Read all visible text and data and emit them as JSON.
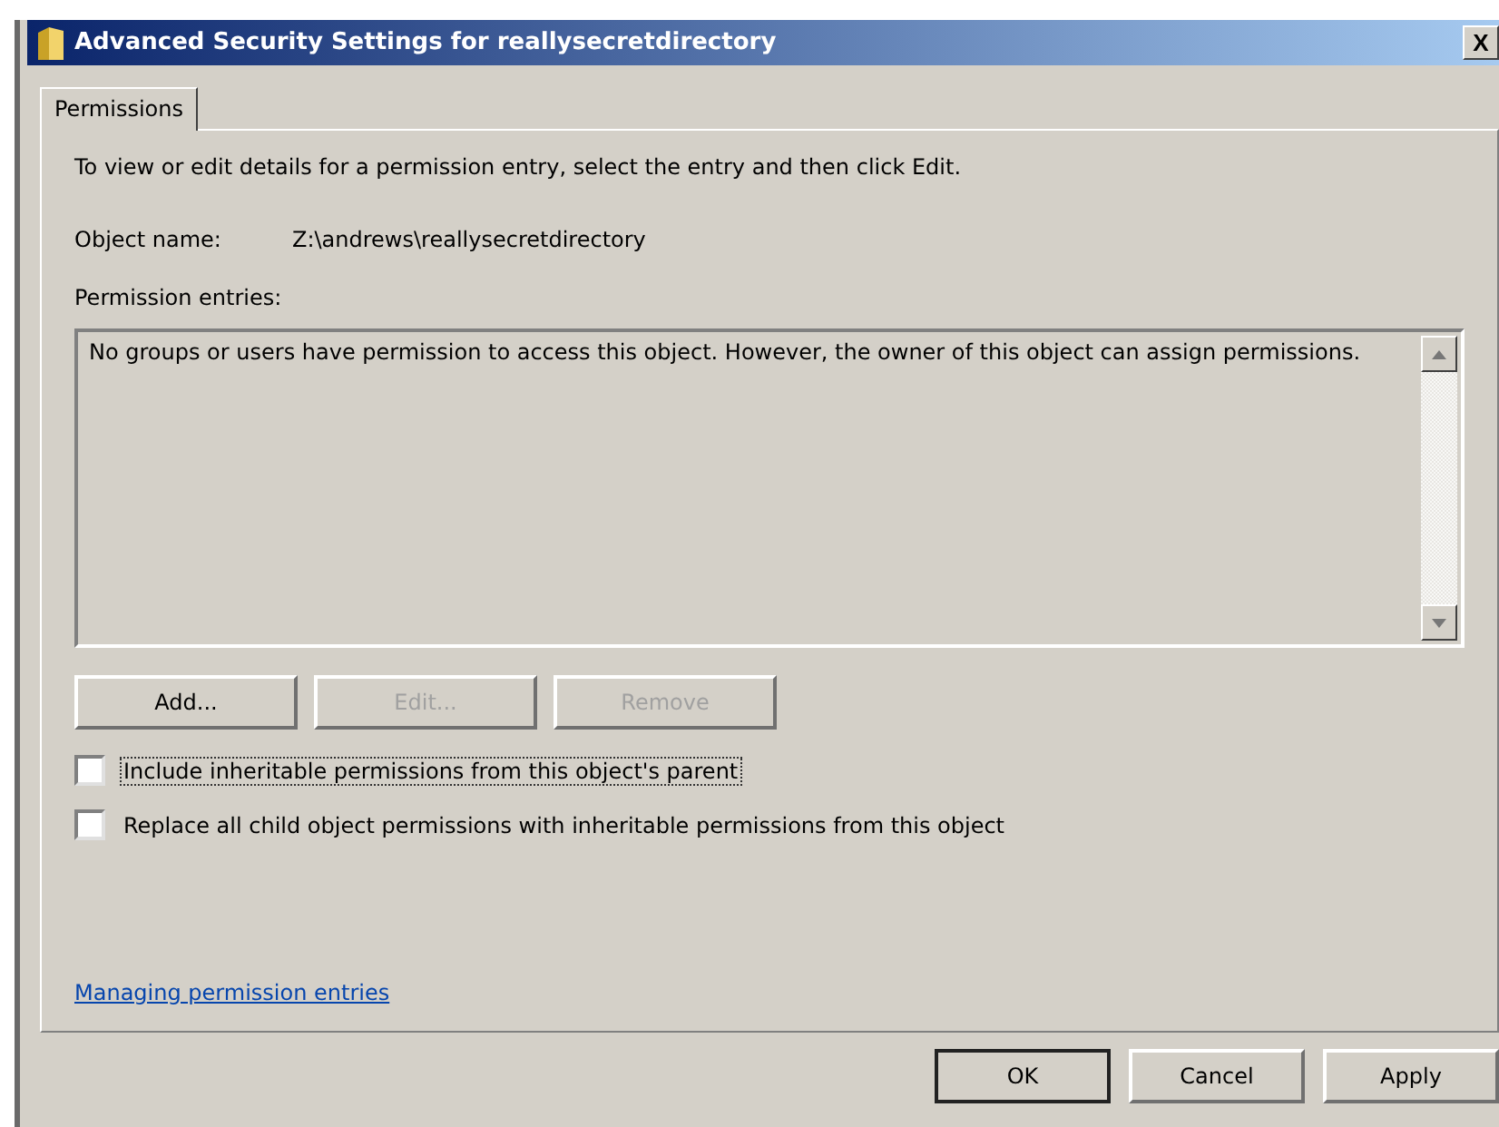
{
  "window": {
    "title": "Advanced Security Settings for reallysecretdirectory",
    "close": "X"
  },
  "tabs": [
    {
      "label": "Permissions",
      "selected": true
    }
  ],
  "intro": "To view or edit details for a permission entry, select the entry and then click Edit.",
  "object_name": {
    "label": "Object name:",
    "value": "Z:\\andrews\\reallysecretdirectory"
  },
  "entries": {
    "label": "Permission entries:",
    "message": "No groups or users have permission to access this object. However, the owner of this object can assign permissions."
  },
  "entry_buttons": [
    {
      "label": "Add...",
      "disabled": false
    },
    {
      "label": "Edit...",
      "disabled": true
    },
    {
      "label": "Remove",
      "disabled": true
    }
  ],
  "options": [
    {
      "label": "Include inheritable permissions from this object's parent",
      "checked": false,
      "focused": true
    },
    {
      "label": "Replace all child object permissions with inheritable permissions from this object",
      "checked": false,
      "focused": false
    }
  ],
  "help_link": "Managing permission entries",
  "buttons": [
    {
      "label": "OK",
      "default": true
    },
    {
      "label": "Cancel",
      "default": false
    },
    {
      "label": "Apply",
      "default": false
    }
  ]
}
